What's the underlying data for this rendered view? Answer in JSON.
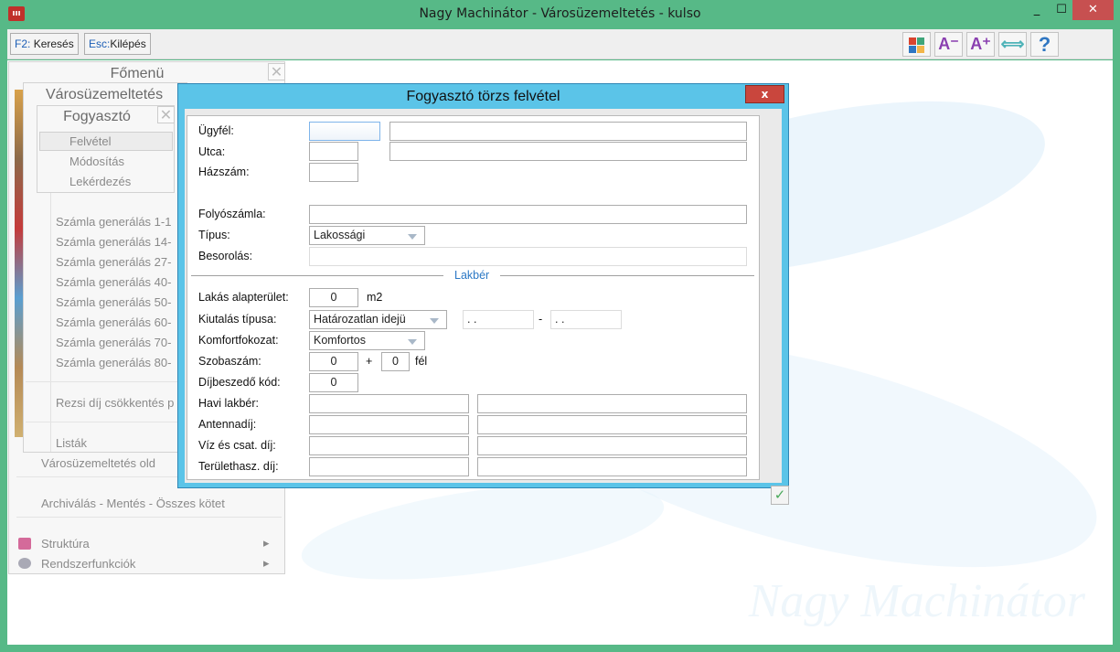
{
  "window": {
    "title": "Nagy Machinátor - Városüzemeltetés - kulso",
    "logo_text": "ооо",
    "minimize": "_",
    "maximize": "☐",
    "close": "✕"
  },
  "toolbar": {
    "search": {
      "key": "F2:",
      "label": "Keresés"
    },
    "exit": {
      "key": "Esc:",
      "label": "Kilépés"
    },
    "icons": [
      {
        "name": "tiles-icon"
      },
      {
        "name": "font-decrease-icon",
        "text": "A⁻"
      },
      {
        "name": "font-increase-icon",
        "text": "A⁺"
      },
      {
        "name": "resize-icon",
        "text": "⟺"
      },
      {
        "name": "help-icon",
        "text": "?"
      }
    ]
  },
  "main_menu": {
    "title": "Főmenü",
    "close": "✕",
    "items": [
      "Városüzemeltetés old",
      "Archiválás - Mentés - Összes kötet",
      "Struktúra",
      "Rendszerfunkciók"
    ],
    "submenu_arrow": "▸"
  },
  "varos_menu": {
    "title": "Városüzemeltetés",
    "items": [
      "Számla generálás 1-1",
      "Számla generálás 14-",
      "Számla generálás 27-",
      "Számla generálás 40-",
      "Számla generálás 50-",
      "Számla generálás 60-",
      "Számla generálás 70-",
      "Számla generálás 80-",
      "Rezsi díj csökkentés p",
      "Listák"
    ]
  },
  "fogyaszto_menu": {
    "title": "Fogyasztó",
    "close": "✕",
    "items": [
      "Felvétel",
      "Módosítás",
      "Lekérdezés"
    ],
    "selected": "Felvétel"
  },
  "dialog": {
    "title": "Fogyasztó törzs felvétel",
    "close": "x",
    "ok": "✓",
    "labels": {
      "ugyfel": "Ügyfél:",
      "utca": "Utca:",
      "hazszam": "Házszám:",
      "folyoszamla": "Folyószámla:",
      "tipus": "Típus:",
      "besorolas": "Besorolás:",
      "section": "Lakbér",
      "alapterulet": "Lakás alapterület:",
      "kiutalas": "Kiutalás típusa:",
      "komfort": "Komfortfokozat:",
      "szobaszam": "Szobaszám:",
      "dijbeszedo": "Díjbeszedő kód:",
      "havi": "Havi lakbér:",
      "antenna": "Antennadíj:",
      "viz": "Víz és csat. díj:",
      "terulet": "Területhasz. díj:"
    },
    "values": {
      "tipus": "Lakossági",
      "alapterulet": "0",
      "unit_m2": "m2",
      "kiutalas": "Határozatlan idejü",
      "date_from": ". .",
      "dash": "-",
      "date_to": ". .",
      "komfort": "Komfortos",
      "szoba": "0",
      "plus": "+",
      "fel_szoba": "0",
      "fel": "fél",
      "dijbeszedo": "0"
    }
  },
  "watermark": "Nagy Machinátor"
}
